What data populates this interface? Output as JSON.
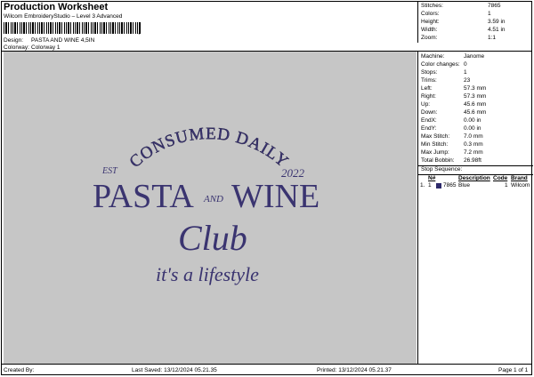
{
  "header": {
    "title": "Production Worksheet",
    "software": "Wilcom EmbroideryStudio – Level 3 Advanced",
    "design_label": "Design:",
    "design_value": "PASTA AND WINE 4,5IN",
    "colorway_label": "Colorway:",
    "colorway_value": "Colorway 1"
  },
  "summary": [
    {
      "label": "Stitches:",
      "value": "7865"
    },
    {
      "label": "Colors:",
      "value": "1"
    },
    {
      "label": "Height:",
      "value": "3.59 in"
    },
    {
      "label": "Width:",
      "value": "4.51 in"
    },
    {
      "label": "Zoom:",
      "value": "1:1"
    }
  ],
  "machine_info": [
    {
      "label": "Machine:",
      "value": "Janome"
    },
    {
      "label": "Color changes:",
      "value": "0"
    },
    {
      "label": "Stops:",
      "value": "1"
    },
    {
      "label": "Trims:",
      "value": "23"
    },
    {
      "label": "Left:",
      "value": "57.3 mm"
    },
    {
      "label": "Right:",
      "value": "57.3 mm"
    },
    {
      "label": "Up:",
      "value": "45.6 mm"
    },
    {
      "label": "Down:",
      "value": "45.6 mm"
    },
    {
      "label": "EndX:",
      "value": "0.00 in"
    },
    {
      "label": "EndY:",
      "value": "0.00 in"
    },
    {
      "label": "Max Stitch:",
      "value": "7.0 mm"
    },
    {
      "label": "Min Stitch:",
      "value": "0.3 mm"
    },
    {
      "label": "Max Jump:",
      "value": "7.2 mm"
    },
    {
      "label": "Total Bobbin:",
      "value": "26.98ft"
    }
  ],
  "stop_sequence": {
    "heading": "Stop Sequence:",
    "columns": [
      "N#",
      "Description",
      "Code",
      "Brand"
    ],
    "rows": [
      {
        "stop": "1.",
        "num": "1",
        "swatch": "#2e2a6b",
        "stitches": "7865",
        "description": "Blue",
        "code": "1",
        "brand": "Wilcom"
      }
    ]
  },
  "design": {
    "background": "#c6c6c6",
    "thread_color": "#3a3470",
    "arc_text": "CONSUMED DAILY",
    "est": "EST",
    "year": "2022",
    "pasta": "PASTA",
    "and": "AND",
    "wine": "WINE",
    "club": "Club",
    "tagline": "it's a lifestyle"
  },
  "footer": {
    "created_by": "Created By:",
    "last_saved": "Last Saved: 13/12/2024 05.21.35",
    "printed": "Printed: 13/12/2024 05.21.37",
    "page": "Page 1 of 1"
  }
}
